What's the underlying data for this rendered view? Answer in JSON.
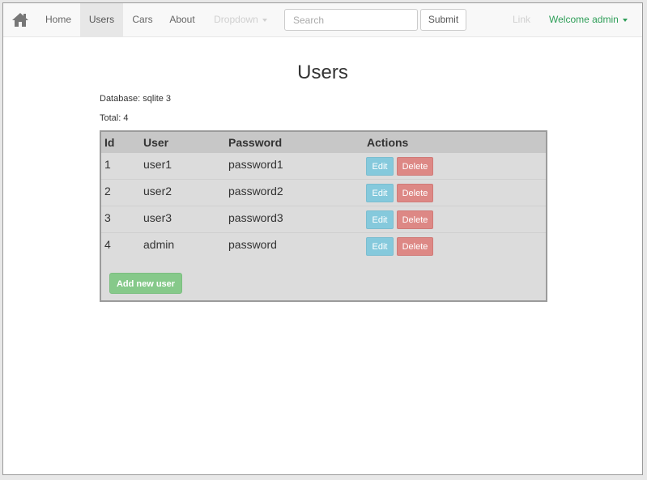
{
  "navbar": {
    "brand_icon": "home-icon",
    "items": [
      {
        "label": "Home"
      },
      {
        "label": "Users",
        "active": true
      },
      {
        "label": "Cars"
      },
      {
        "label": "About"
      },
      {
        "label": "Dropdown",
        "disabled": true
      }
    ],
    "search": {
      "placeholder": "Search",
      "value": ""
    },
    "submit_label": "Submit",
    "link_label": "Link",
    "welcome_label": "Welcome admin"
  },
  "page": {
    "title": "Users",
    "database_text": "Database: sqlite 3",
    "total_text": "Total: 4"
  },
  "table": {
    "headers": [
      "Id",
      "User",
      "Password",
      "Actions"
    ],
    "rows": [
      {
        "id": "1",
        "user": "user1",
        "password": "password1"
      },
      {
        "id": "2",
        "user": "user2",
        "password": "password2"
      },
      {
        "id": "3",
        "user": "user3",
        "password": "password3"
      },
      {
        "id": "4",
        "user": "admin",
        "password": "password"
      }
    ],
    "edit_label": "Edit",
    "delete_label": "Delete",
    "add_label": "Add new user"
  },
  "colors": {
    "accent_green": "#2e9e58",
    "edit_button": "#85c9dc",
    "delete_button": "#dd8885",
    "add_button": "#86c98a"
  }
}
